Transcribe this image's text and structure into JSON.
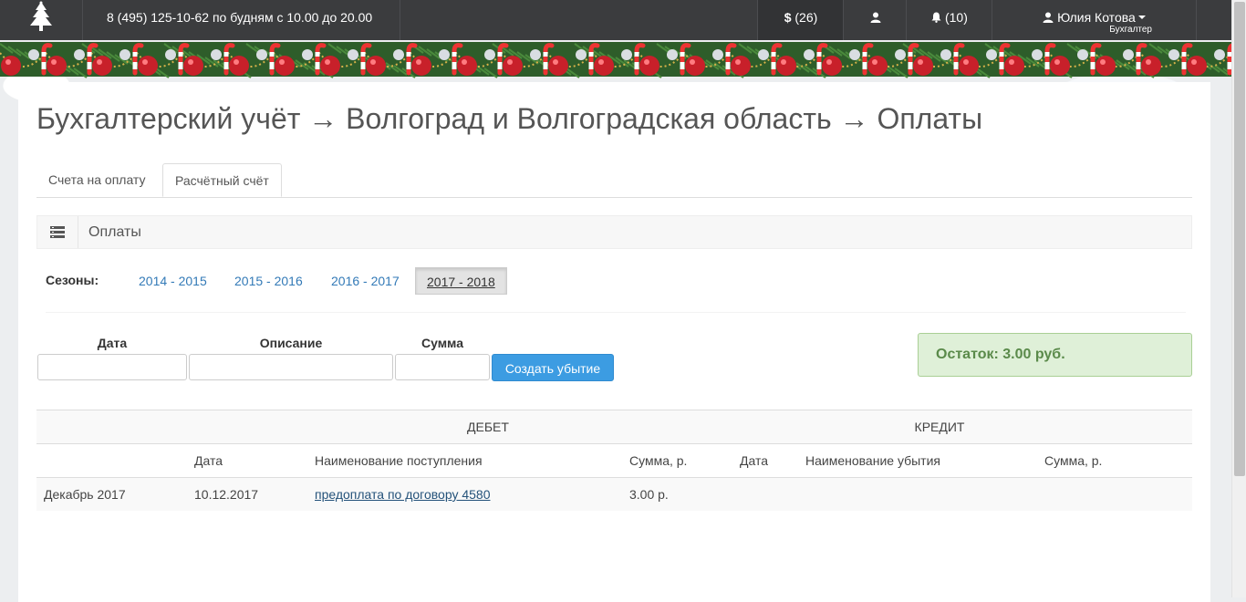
{
  "header": {
    "phone": "8 (495) 125-10-62 по будням с 10.00 до 20.00",
    "money_label": "$",
    "money_count": "(26)",
    "notifications_count": "(10)",
    "user_name": "Юлия Котова",
    "user_role": "Бухгалтер"
  },
  "page": {
    "title": "Бухгалтерский учёт → Волгоград и Волгоградская область → Оплаты"
  },
  "tabs": [
    {
      "label": "Счета на оплату",
      "active": false
    },
    {
      "label": "Расчётный счёт",
      "active": true
    }
  ],
  "box": {
    "title": "Оплаты"
  },
  "seasons": {
    "label": "Сезоны:",
    "items": [
      "2014 - 2015",
      "2015 - 2016",
      "2016 - 2017",
      "2017 - 2018"
    ],
    "active": "2017 - 2018"
  },
  "form": {
    "date_label": "Дата",
    "desc_label": "Описание",
    "sum_label": "Сумма",
    "date_value": "",
    "desc_value": "",
    "sum_value": "",
    "create_button": "Создать убытие"
  },
  "balance": {
    "text": "Остаток: 3.00 руб."
  },
  "table": {
    "debit_header": "ДЕБЕТ",
    "credit_header": "КРЕДИТ",
    "columns": [
      "",
      "Дата",
      "Наименование поступления",
      "Сумма, р.",
      "Дата",
      "Наименование убытия",
      "Сумма, р."
    ],
    "rows": [
      [
        "Декабрь 2017",
        "10.12.2017",
        "предоплата по договору 4580 ",
        "3.00 р.",
        "",
        "",
        ""
      ]
    ]
  },
  "colors": {
    "navbar": "#3b3c3e",
    "link": "#337ab7",
    "button": "#3c9ce2",
    "success_bg": "#dff0d8",
    "success_text": "#5a8a4a"
  },
  "icons": [
    "tree-logo-icon",
    "profile-icon",
    "bell-icon",
    "user-icon",
    "list-icon"
  ]
}
